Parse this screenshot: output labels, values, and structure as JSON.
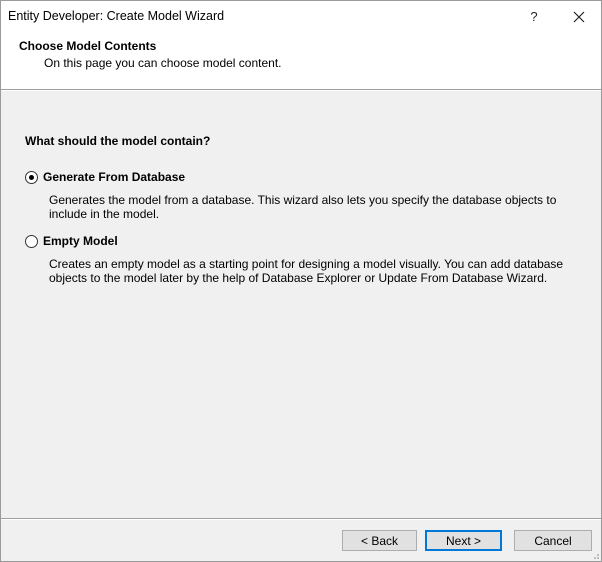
{
  "window": {
    "title": "Entity Developer: Create Model Wizard",
    "help_label": "?"
  },
  "header": {
    "title": "Choose Model Contents",
    "subtitle": "On this page you can choose model content."
  },
  "main": {
    "question": "What should the model contain?",
    "options": [
      {
        "label": "Generate From Database",
        "description": "Generates the model from a database. This wizard also lets you specify the database objects to include in the model.",
        "selected": true
      },
      {
        "label": "Empty Model",
        "description": "Creates an empty model as a starting point for designing a model visually. You can add database objects to the model later by the help of Database Explorer or Update From Database Wizard.",
        "selected": false
      }
    ]
  },
  "footer": {
    "back_label": "< Back",
    "next_label": "Next >",
    "cancel_label": "Cancel"
  },
  "colors": {
    "dialog_bg": "#f0f0f0",
    "header_bg": "#ffffff",
    "default_button_border": "#0078d7"
  }
}
